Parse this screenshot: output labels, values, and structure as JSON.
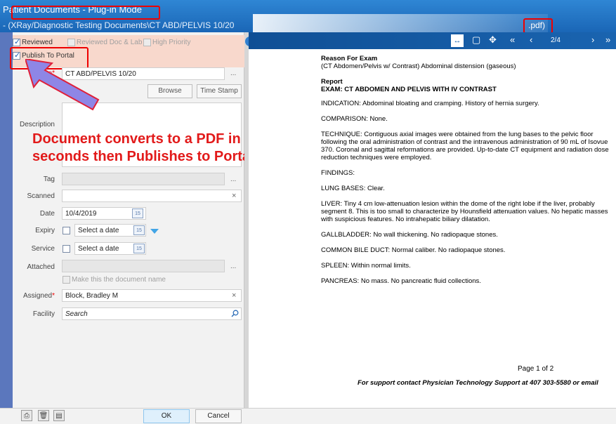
{
  "window": {
    "title": "Patient Documents - Plug-in Mode",
    "path": "- (XRay/Diagnostic Testing Documents\\CT ABD/PELVIS 10/20",
    "ext": ".pdf)"
  },
  "checks": {
    "reviewed": {
      "label": "Reviewed",
      "checked": true
    },
    "reviewed_doc_lab": {
      "label": "Reviewed Doc & Lab",
      "checked": false
    },
    "high_priority": {
      "label": "High Priority",
      "checked": false
    },
    "publish": {
      "label": "Publish To Portal",
      "checked": true
    }
  },
  "form": {
    "name_label": "Name",
    "name_value": "CT ABD/PELVIS 10/20",
    "browse": "Browse",
    "timestamp": "Time Stamp",
    "description_label": "Description",
    "tag_label": "Tag",
    "scanned_label": "Scanned",
    "date_label": "Date",
    "date_value": "10/4/2019",
    "expiry_label": "Expiry",
    "expiry_placeholder": "Select a date",
    "service_label": "Service",
    "service_placeholder": "Select a date",
    "attached_label": "Attached",
    "make_doc_name": "Make this the document name",
    "assigned_label": "Assigned",
    "assigned_value": "Block, Bradley M",
    "facility_label": "Facility",
    "facility_placeholder": "Search",
    "calendar_day": "15",
    "ellipsis": "...",
    "clear_symbol": "×",
    "required_mark": "*"
  },
  "annotation": {
    "line1": "Document converts to a PDF in",
    "line2": "seconds then Publishes to Portal"
  },
  "viewer": {
    "page_indicator": "2/4",
    "report": {
      "reason_heading": "Reason For Exam",
      "reason_text": "(CT Abdomen/Pelvis w/ Contrast) Abdominal distension (gaseous)",
      "report_heading": "Report",
      "exam": "EXAM: CT ABDOMEN AND PELVIS WITH IV CONTRAST",
      "indication": "INDICATION: Abdominal bloating and cramping. History of hernia surgery.",
      "comparison": "COMPARISON: None.",
      "technique": "TECHNIQUE: Contiguous axial images were obtained from the lung bases to the pelvic floor following the oral administration of contrast and the intravenous administration of 90 mL of Isovue 370. Coronal and sagittal reformations are provided. Up-to-date CT equipment and radiation dose reduction techniques were employed.",
      "findings": "FINDINGS:",
      "lung": "LUNG BASES: Clear.",
      "liver": "LIVER: Tiny 4 cm low-attenuation lesion within the dome of the right lobe if the liver, probably segment 8. This is too small to characterize by Hounsfield attenuation values. No hepatic masses with suspicious features. No intrahepatic biliary dilatation.",
      "gallbladder": "GALLBLADDER: No wall thickening. No radiopaque stones.",
      "cbd": "COMMON BILE DUCT: Normal caliber. No radiopaque stones.",
      "spleen": "SPLEEN: Within normal limits.",
      "pancreas": "PANCREAS: No mass.  No pancreatic fluid collections."
    },
    "page_footer": "Page 1 of 2",
    "support": "For support contact Physician Technology Support at 407 303-5580 or email"
  },
  "footer": {
    "ok": "OK",
    "cancel": "Cancel"
  },
  "icons": [
    "fit-width-icon",
    "fit-page-icon",
    "pan-icon",
    "first-page-icon",
    "prev-page-icon",
    "next-page-icon",
    "last-page-icon",
    "scanner-icon",
    "delete-icon",
    "print-icon",
    "calendar-icon",
    "search-icon"
  ],
  "colors": {
    "title_bar": "#1a66b6",
    "annotation_red": "#e21a1a",
    "highlight_pink": "#f8d8cc"
  }
}
